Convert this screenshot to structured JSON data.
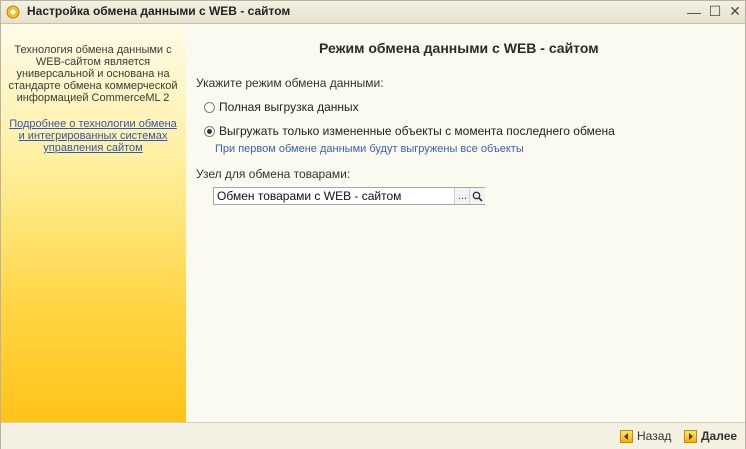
{
  "window": {
    "title": "Настройка обмена данными с WEB - сайтом",
    "minimize_glyph": "—",
    "maximize_glyph": "☐",
    "close_glyph": "✕"
  },
  "sidebar": {
    "description": "Технология обмена данными с WEB-сайтом является универсальной и основана на стандарте обмена коммерческой информацией CommerceML 2",
    "link": "Подробнее о технологии обмена и интегрированных системах управления сайтом"
  },
  "main": {
    "title": "Режим обмена данными с WEB - сайтом",
    "mode_label": "Укажите режим обмена данными:",
    "options": [
      {
        "label": "Полная выгрузка данных",
        "selected": false
      },
      {
        "label": "Выгружать только измененные объекты с момента последнего обмена",
        "selected": true
      }
    ],
    "hint": "При первом обмене данными будут выгружены все объекты",
    "node_label": "Узел для обмена товарами:",
    "node_value": "Обмен товарами с WEB - сайтом",
    "select_button": "...",
    "search_icon": "magnifier-icon"
  },
  "footer": {
    "back_label": "Назад",
    "next_label": "Далее",
    "back_icon": "arrow-left-icon",
    "next_icon": "arrow-right-icon"
  },
  "colors": {
    "link": "#2f56b8",
    "hint": "#3b5fb6",
    "sidebar_bottom": "#ffc318"
  }
}
